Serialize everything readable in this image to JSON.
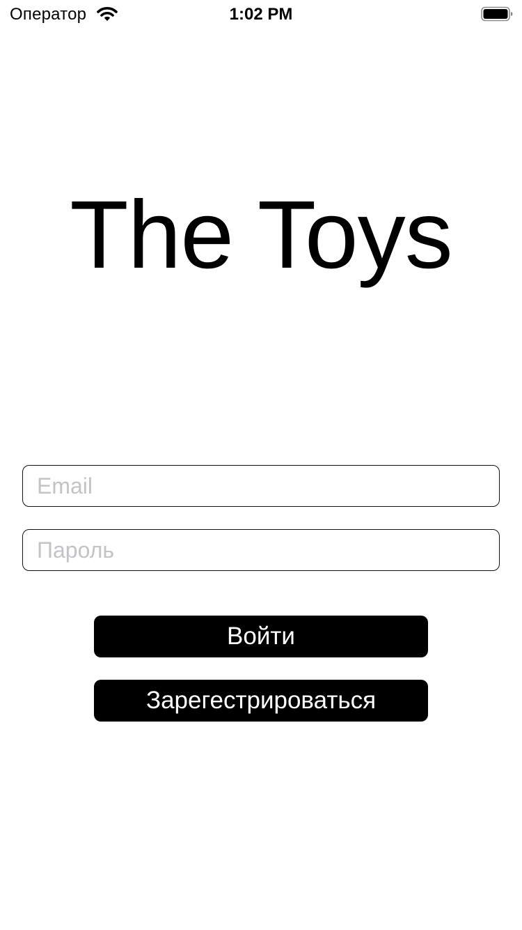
{
  "status_bar": {
    "carrier": "Оператор",
    "time": "1:02 PM",
    "wifi_icon": "wifi-icon",
    "battery_icon": "battery-full-icon"
  },
  "app": {
    "title": "The Toys"
  },
  "form": {
    "email_placeholder": "Email",
    "email_value": "",
    "password_placeholder": "Пароль",
    "password_value": ""
  },
  "actions": {
    "login_label": "Войти",
    "register_label": "Зарегестрироваться"
  },
  "colors": {
    "background": "#ffffff",
    "button_background": "#000000",
    "button_text": "#ffffff",
    "placeholder": "#c3c3c8"
  }
}
